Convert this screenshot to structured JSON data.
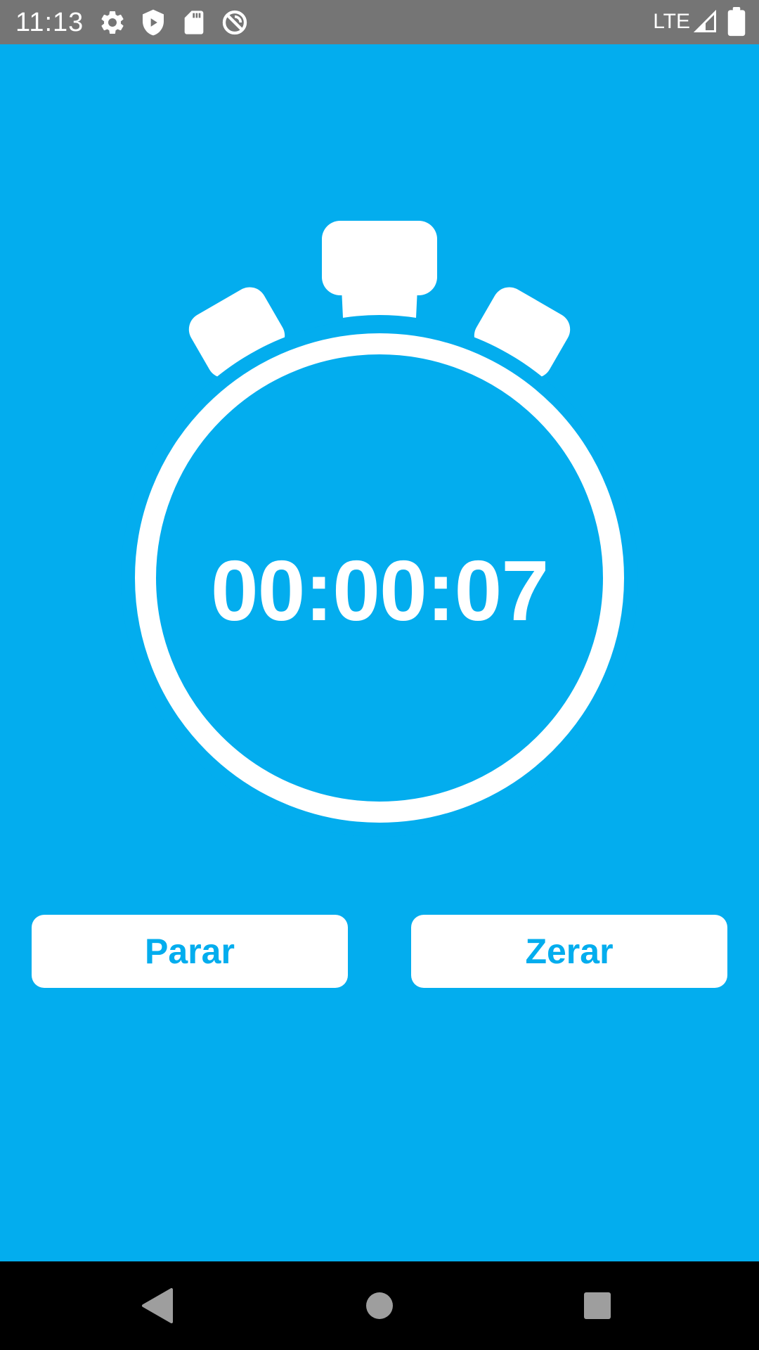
{
  "status_bar": {
    "time": "11:13",
    "network": "LTE",
    "icons": [
      "gear-icon",
      "shield-icon",
      "sd-card-icon",
      "no-sync-icon",
      "signal-icon",
      "battery-icon"
    ]
  },
  "timer": {
    "display": "00:00:07"
  },
  "buttons": {
    "stop_label": "Parar",
    "reset_label": "Zerar"
  },
  "navigation": {
    "icons": [
      "back-icon",
      "home-icon",
      "recents-icon"
    ]
  },
  "colors": {
    "background": "#03ADEE",
    "status_bar": "#757575",
    "foreground": "#FFFFFF",
    "nav_bar": "#000000"
  }
}
